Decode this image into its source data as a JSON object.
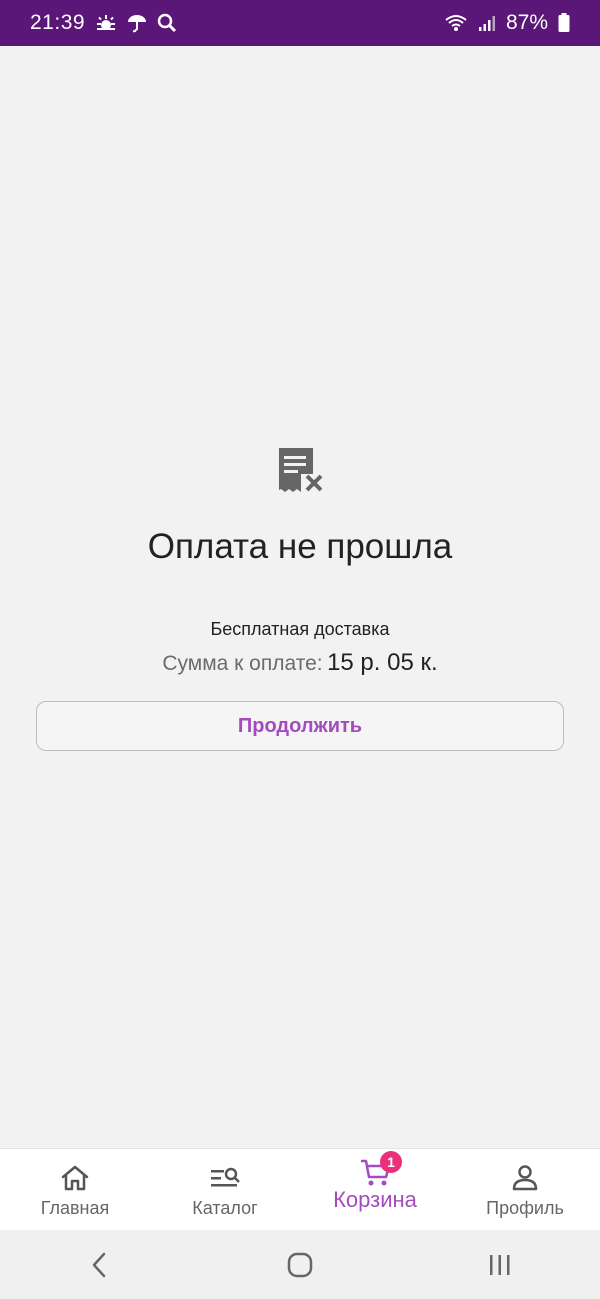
{
  "status_bar": {
    "time": "21:39",
    "battery_percent": "87%",
    "icons_left": [
      "weather-sun-icon",
      "umbrella-icon",
      "search-icon"
    ],
    "icons_right": [
      "wifi-icon",
      "signal-icon",
      "battery-icon"
    ]
  },
  "main": {
    "icon": "receipt-cancel-icon",
    "title": "Оплата не прошла",
    "delivery": "Бесплатная доставка",
    "sum_label": "Сумма к оплате:",
    "sum_value": "15 р. 05 к.",
    "continue_label": "Продолжить"
  },
  "bottom_nav": {
    "items": [
      {
        "label": "Главная",
        "icon": "home-icon",
        "active": false
      },
      {
        "label": "Каталог",
        "icon": "catalog-search-icon",
        "active": false
      },
      {
        "label": "Корзина",
        "icon": "cart-icon",
        "active": true,
        "badge": "1"
      },
      {
        "label": "Профиль",
        "icon": "profile-icon",
        "active": false
      }
    ]
  },
  "system_nav": {
    "buttons": [
      "back-icon",
      "home-circle-icon",
      "recents-icon"
    ]
  },
  "colors": {
    "status_bar": "#5a1777",
    "accent": "#a44bbd",
    "badge": "#e8317a",
    "background": "#f2f2f2"
  }
}
